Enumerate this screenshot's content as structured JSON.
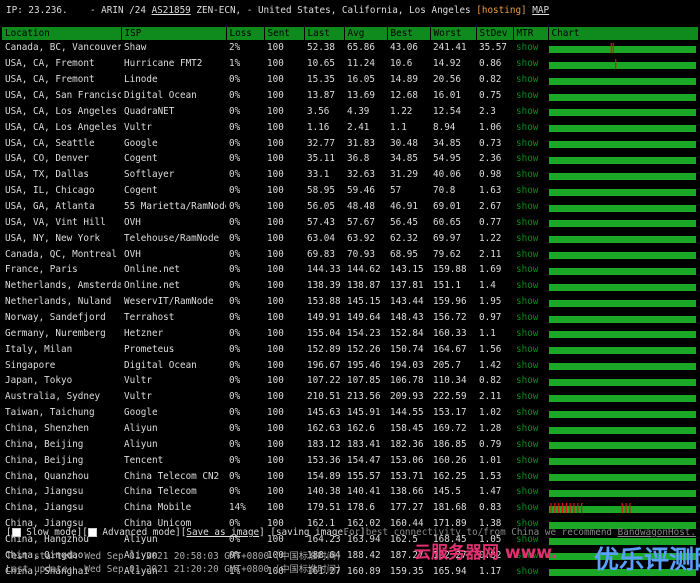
{
  "header": {
    "ip_label": "IP:",
    "ip": "23.236.",
    "arin": "- ARIN /24",
    "asn": "AS21859",
    "provider": "ZEN-ECN,",
    "location": "- United States, California, Los Angeles",
    "hosting": "[hosting]",
    "map": "MAP"
  },
  "columns": [
    "Location",
    "ISP",
    "Loss",
    "Sent",
    "Last",
    "Avg",
    "Best",
    "Worst",
    "StDev",
    "MTR",
    "Chart"
  ],
  "rows": [
    [
      "Canada, BC, Vancouver",
      "Shaw",
      "2%",
      "100",
      "52.38",
      "65.86",
      "43.06",
      "241.41",
      "35.57",
      "show"
    ],
    [
      "USA, CA, Fremont",
      "Hurricane FMT2",
      "1%",
      "100",
      "10.65",
      "11.24",
      "10.6",
      "14.92",
      "0.86",
      "show"
    ],
    [
      "USA, CA, Fremont",
      "Linode",
      "0%",
      "100",
      "15.35",
      "16.05",
      "14.89",
      "20.56",
      "0.82",
      "show"
    ],
    [
      "USA, CA, San Francisco",
      "Digital Ocean",
      "0%",
      "100",
      "13.87",
      "13.69",
      "12.68",
      "16.01",
      "0.75",
      "show"
    ],
    [
      "USA, CA, Los Angeles",
      "QuadraNET",
      "0%",
      "100",
      "3.56",
      "4.39",
      "1.22",
      "12.54",
      "2.3",
      "show"
    ],
    [
      "USA, CA, Los Angeles",
      "Vultr",
      "0%",
      "100",
      "1.16",
      "2.41",
      "1.1",
      "8.94",
      "1.06",
      "show"
    ],
    [
      "USA, CA, Seattle",
      "Google",
      "0%",
      "100",
      "32.77",
      "31.83",
      "30.48",
      "34.85",
      "0.73",
      "show"
    ],
    [
      "USA, CO, Denver",
      "Cogent",
      "0%",
      "100",
      "35.11",
      "36.8",
      "34.85",
      "54.95",
      "2.36",
      "show"
    ],
    [
      "USA, TX, Dallas",
      "Softlayer",
      "0%",
      "100",
      "33.1",
      "32.63",
      "31.29",
      "40.06",
      "0.98",
      "show"
    ],
    [
      "USA, IL, Chicago",
      "Cogent",
      "0%",
      "100",
      "58.95",
      "59.46",
      "57",
      "70.8",
      "1.63",
      "show"
    ],
    [
      "USA, GA, Atlanta",
      "55 Marietta/RamNode",
      "0%",
      "100",
      "56.05",
      "48.48",
      "46.91",
      "69.01",
      "2.67",
      "show"
    ],
    [
      "USA, VA, Vint Hill",
      "OVH",
      "0%",
      "100",
      "57.43",
      "57.67",
      "56.45",
      "60.65",
      "0.77",
      "show"
    ],
    [
      "USA, NY, New York",
      "Telehouse/RamNode",
      "0%",
      "100",
      "63.04",
      "63.92",
      "62.32",
      "69.97",
      "1.22",
      "show"
    ],
    [
      "Canada, QC, Montreal",
      "OVH",
      "0%",
      "100",
      "69.83",
      "70.93",
      "68.95",
      "79.62",
      "2.11",
      "show"
    ],
    [
      "France, Paris",
      "Online.net",
      "0%",
      "100",
      "144.33",
      "144.62",
      "143.15",
      "159.88",
      "1.69",
      "show"
    ],
    [
      "Netherlands, Amsterdam",
      "Online.net",
      "0%",
      "100",
      "138.39",
      "138.87",
      "137.81",
      "151.1",
      "1.4",
      "show"
    ],
    [
      "Netherlands, Nuland",
      "WeservIT/RamNode",
      "0%",
      "100",
      "153.88",
      "145.15",
      "143.44",
      "159.96",
      "1.95",
      "show"
    ],
    [
      "Norway, Sandefjord",
      "Terrahost",
      "0%",
      "100",
      "149.91",
      "149.64",
      "148.43",
      "156.72",
      "0.97",
      "show"
    ],
    [
      "Germany, Nuremberg",
      "Hetzner",
      "0%",
      "100",
      "155.04",
      "154.23",
      "152.84",
      "160.33",
      "1.1",
      "show"
    ],
    [
      "Italy, Milan",
      "Prometeus",
      "0%",
      "100",
      "152.89",
      "152.26",
      "150.74",
      "164.67",
      "1.56",
      "show"
    ],
    [
      "Singapore",
      "Digital Ocean",
      "0%",
      "100",
      "196.67",
      "195.46",
      "194.03",
      "205.7",
      "1.42",
      "show"
    ],
    [
      "Japan, Tokyo",
      "Vultr",
      "0%",
      "100",
      "107.22",
      "107.85",
      "106.78",
      "110.34",
      "0.82",
      "show"
    ],
    [
      "Australia, Sydney",
      "Vultr",
      "0%",
      "100",
      "210.51",
      "213.56",
      "209.93",
      "222.59",
      "2.11",
      "show"
    ],
    [
      "Taiwan, Taichung",
      "Google",
      "0%",
      "100",
      "145.63",
      "145.91",
      "144.55",
      "153.17",
      "1.02",
      "show"
    ],
    [
      "China, Shenzhen",
      "Aliyun",
      "0%",
      "100",
      "162.63",
      "162.6",
      "158.45",
      "169.72",
      "1.28",
      "show"
    ],
    [
      "China, Beijing",
      "Aliyun",
      "0%",
      "100",
      "183.12",
      "183.41",
      "182.36",
      "186.85",
      "0.79",
      "show"
    ],
    [
      "China, Beijing",
      "Tencent",
      "0%",
      "100",
      "153.36",
      "154.47",
      "153.06",
      "160.26",
      "1.01",
      "show"
    ],
    [
      "China, Quanzhou",
      "China Telecom CN2",
      "0%",
      "100",
      "154.89",
      "155.57",
      "153.71",
      "162.25",
      "1.53",
      "show"
    ],
    [
      "China, Jiangsu",
      "China Telecom",
      "0%",
      "100",
      "140.38",
      "140.41",
      "138.66",
      "145.5",
      "1.47",
      "show"
    ],
    [
      "China, Jiangsu",
      "China Mobile",
      "14%",
      "100",
      "179.51",
      "178.6",
      "177.27",
      "181.68",
      "0.83",
      "show"
    ],
    [
      "China, Jiangsu",
      "China Unicom",
      "0%",
      "100",
      "162.1",
      "162.02",
      "160.44",
      "171.89",
      "1.38",
      "show"
    ],
    [
      "China, Hangzhou",
      "Aliyun",
      "0%",
      "100",
      "164.23",
      "163.94",
      "162.5",
      "168.45",
      "1.05",
      "show"
    ],
    [
      "China, Qingdao",
      "Aliyun",
      "0%",
      "100",
      "188.64",
      "188.42",
      "187.27",
      "192.27",
      "0.82",
      "show"
    ],
    [
      "China, Shanghai",
      "Aliyun",
      "1%",
      "100",
      "161.27",
      "160.89",
      "159.35",
      "165.94",
      "1.17",
      "show"
    ]
  ],
  "footer": {
    "slow_mode": "Slow mode",
    "advanced_mode": "Advanced mode",
    "save_as_image": "Save as image",
    "saving": "saving image...",
    "recommend": "For best connectivity to/from China we recommend",
    "recommend_link": "BandwagonHost.",
    "test_started": "Test started: Wed Sep 01 2021 20:58:03 GMT+0800 (中国标准时间)",
    "last_update": "Last update:  Wed Sep 01 2021 21:20:20 GMT+0800 (中国标准时间)",
    "watermark_left": "云服务器网 www.",
    "watermark_right": "优乐评测网"
  },
  "colors": {
    "header_bg": "#0f8a1c",
    "show_link": "#0c8a18",
    "chart_ok": "#1aa826",
    "chart_loss": "#e01010"
  }
}
